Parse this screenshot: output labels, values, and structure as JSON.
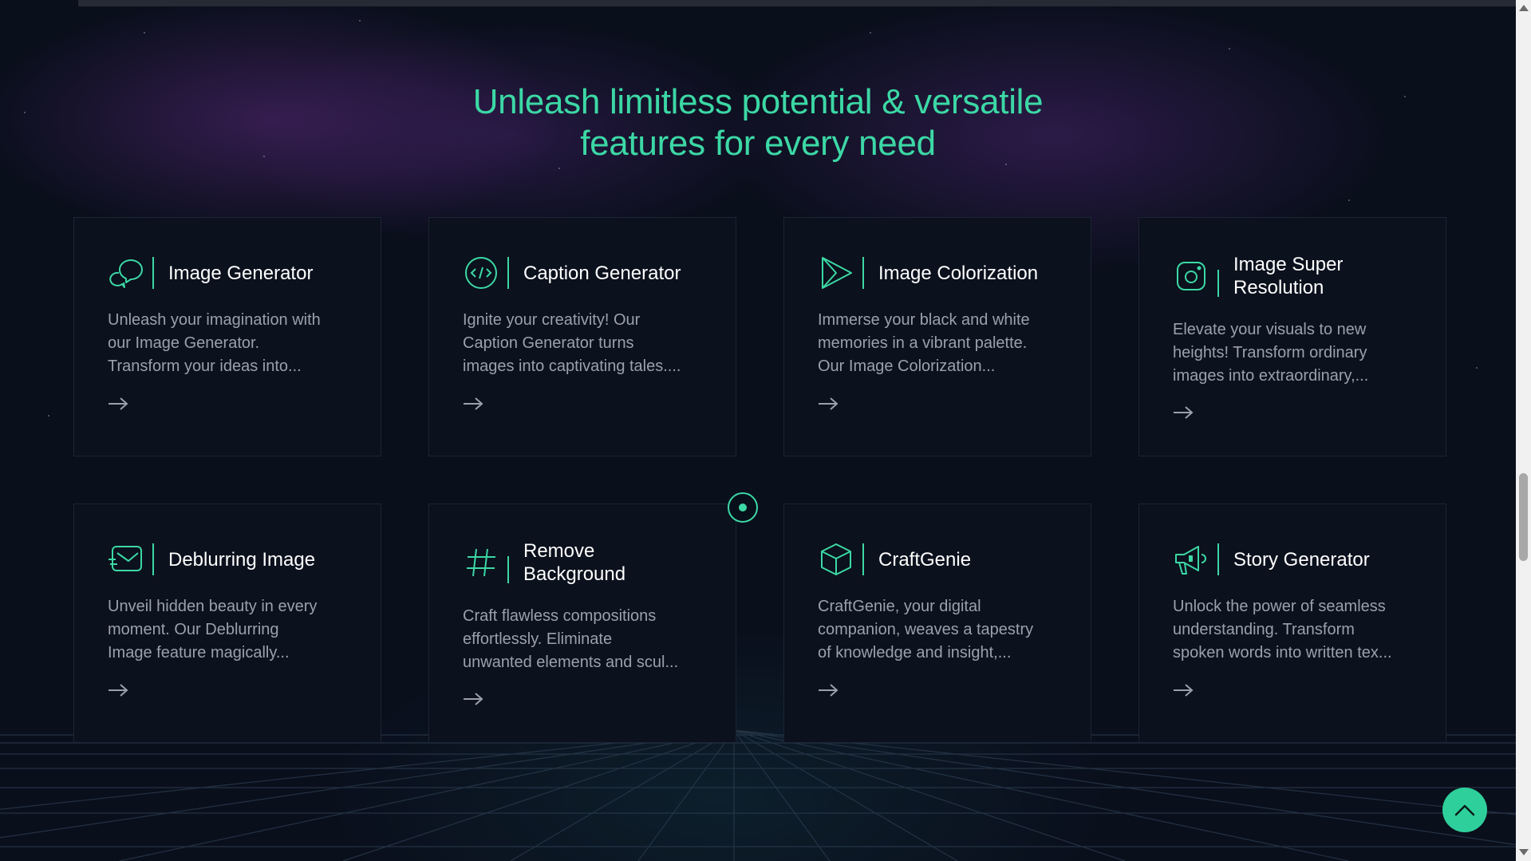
{
  "section": {
    "heading_line1": "Unleash limitless potential & versatile",
    "heading_line2": "features for every need"
  },
  "colors": {
    "accent": "#3cd8a5",
    "background": "#0a0f1c",
    "card_background": "#0b111d",
    "card_title": "#ffffff",
    "card_text": "#9aa1ad"
  },
  "features": [
    {
      "title": "Image Generator",
      "description_line1": "Unleash your imagination with",
      "description_line2": "our Image Generator.",
      "description_line3": "Transform your ideas into...",
      "icon": "chat-bubbles-icon"
    },
    {
      "title": "Caption Generator",
      "description_line1": "Ignite your creativity! Our",
      "description_line2": "Caption Generator turns",
      "description_line3": "images into captivating tales....",
      "icon": "code-circle-icon"
    },
    {
      "title": "Image Colorization",
      "description_line1": "Immerse your black and white",
      "description_line2": "memories in a vibrant palette.",
      "description_line3": "Our Image Colorization...",
      "icon": "play-triangle-icon"
    },
    {
      "title_line1": "Image Super",
      "title_line2": "Resolution",
      "description_line1": "Elevate your visuals to new",
      "description_line2": "heights! Transform ordinary",
      "description_line3": "images into extraordinary,...",
      "icon": "camera-icon"
    },
    {
      "title": "Deblurring Image",
      "description_line1": "Unveil hidden beauty in every",
      "description_line2": "moment. Our Deblurring",
      "description_line3": "Image feature magically...",
      "icon": "fast-mail-icon"
    },
    {
      "title_line1": "Remove",
      "title_line2": "Background",
      "description_line1": "Craft flawless compositions",
      "description_line2": "effortlessly. Eliminate",
      "description_line3": "unwanted elements and scul...",
      "icon": "hashtag-icon"
    },
    {
      "title": "CraftGenie",
      "description_line1": "CraftGenie, your digital",
      "description_line2": "companion, weaves a tapestry",
      "description_line3": "of knowledge and insight,...",
      "icon": "cube-icon"
    },
    {
      "title": "Story Generator",
      "description_line1": "Unlock the power of seamless",
      "description_line2": "understanding. Transform",
      "description_line3": "spoken words into written tex...",
      "icon": "megaphone-icon"
    }
  ],
  "icons": {
    "arrow": "arrow-right-icon",
    "back_to_top": "chevron-up-icon"
  }
}
